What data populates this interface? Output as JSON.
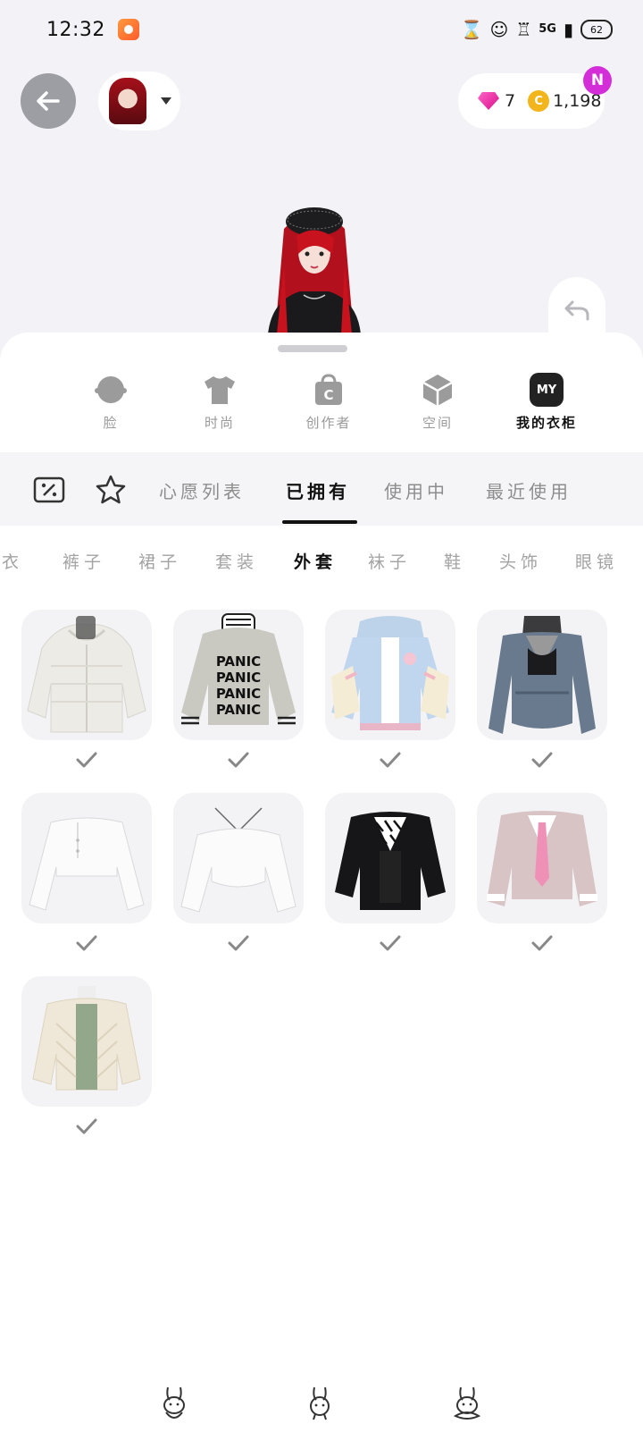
{
  "status_bar": {
    "time": "12:32",
    "network": "5G",
    "battery": "62",
    "icons": [
      "hourglass-icon",
      "mascot-icon",
      "hd-icon",
      "signal-icon",
      "battery-icon"
    ]
  },
  "header": {
    "back_icon": "arrow-left-icon",
    "avatar_dropdown_icon": "caret-down-icon",
    "gems": "7",
    "coins": "1,198",
    "coin_symbol": "C",
    "badge": "N",
    "undo_icon": "undo-icon"
  },
  "categories": [
    {
      "label": "脸",
      "icon": "face-icon",
      "active": false
    },
    {
      "label": "时尚",
      "icon": "shirt-icon",
      "active": false
    },
    {
      "label": "创作者",
      "icon": "creator-bag-icon",
      "active": false
    },
    {
      "label": "空间",
      "icon": "cube-icon",
      "active": false
    },
    {
      "label": "我的衣柜",
      "icon": "my-wardrobe-icon",
      "icon_text": "MY",
      "active": true
    }
  ],
  "tabs": {
    "icons": [
      "coupon-icon",
      "star-icon"
    ],
    "items": [
      {
        "label": "心愿列表",
        "active": false
      },
      {
        "label": "已拥有",
        "active": true
      },
      {
        "label": "使用中",
        "active": false
      },
      {
        "label": "最近使用",
        "active": false
      }
    ]
  },
  "subcategories": [
    {
      "label": "上衣",
      "active": false
    },
    {
      "label": "裤子",
      "active": false
    },
    {
      "label": "裙子",
      "active": false
    },
    {
      "label": "套装",
      "active": false
    },
    {
      "label": "外套",
      "active": true
    },
    {
      "label": "袜子",
      "active": false
    },
    {
      "label": "鞋",
      "active": false
    },
    {
      "label": "头饰",
      "active": false
    },
    {
      "label": "眼镜",
      "active": false
    }
  ],
  "items": [
    {
      "name": "white-knit-hoodie",
      "sweater_text": "",
      "owned": true
    },
    {
      "name": "panic-sweatshirt",
      "sweater_text": "PANIC",
      "owned": true
    },
    {
      "name": "blue-varsity-jacket",
      "sweater_text": "",
      "owned": true
    },
    {
      "name": "denim-jacket",
      "sweater_text": "",
      "owned": true
    },
    {
      "name": "white-crop-cardigan",
      "sweater_text": "",
      "owned": true
    },
    {
      "name": "white-shrug",
      "sweater_text": "",
      "owned": true
    },
    {
      "name": "black-jacket-zebra-top",
      "sweater_text": "",
      "owned": true
    },
    {
      "name": "pink-blazer-tie",
      "sweater_text": "",
      "owned": true
    },
    {
      "name": "cream-quilted-jacket",
      "sweater_text": "",
      "owned": true
    }
  ],
  "bottom_nav": [
    "bunny-home-icon",
    "bunny-center-icon",
    "bunny-recent-icon"
  ]
}
